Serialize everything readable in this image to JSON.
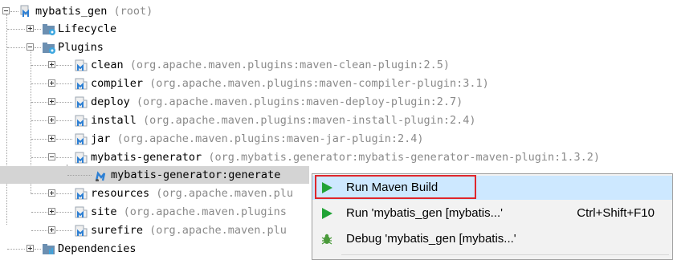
{
  "tree": {
    "root": {
      "name": "mybatis_gen",
      "suffix": "(root)"
    },
    "lifecycle": "Lifecycle",
    "plugins_label": "Plugins",
    "plugins": [
      {
        "name": "clean",
        "coords": "(org.apache.maven.plugins:maven-clean-plugin:2.5)"
      },
      {
        "name": "compiler",
        "coords": "(org.apache.maven.plugins:maven-compiler-plugin:3.1)"
      },
      {
        "name": "deploy",
        "coords": "(org.apache.maven.plugins:maven-deploy-plugin:2.7)"
      },
      {
        "name": "install",
        "coords": "(org.apache.maven.plugins:maven-install-plugin:2.4)"
      },
      {
        "name": "jar",
        "coords": "(org.apache.maven.plugins:maven-jar-plugin:2.4)"
      },
      {
        "name": "mybatis-generator",
        "coords": "(org.mybatis.generator:mybatis-generator-maven-plugin:1.3.2)"
      },
      {
        "name": "resources",
        "coords": "(org.apache.maven.plu"
      },
      {
        "name": "site",
        "coords": "(org.apache.maven.plugins"
      },
      {
        "name": "surefire",
        "coords": "(org.apache.maven.plu"
      }
    ],
    "goal": "mybatis-generator:generate",
    "dependencies": "Dependencies"
  },
  "context_menu": {
    "items": [
      {
        "label": "Run Maven Build",
        "shortcut": "",
        "icon": "run-icon"
      },
      {
        "label": "Run 'mybatis_gen [mybatis...'",
        "shortcut": "Ctrl+Shift+F10",
        "icon": "run-icon"
      },
      {
        "label": "Debug 'mybatis_gen [mybatis...'",
        "shortcut": "",
        "icon": "debug-icon"
      }
    ]
  },
  "colors": {
    "run_green": "#21a336",
    "highlight": "#cde8ff",
    "annotation_red": "#e0262b",
    "selection": "#d4d4d4"
  }
}
